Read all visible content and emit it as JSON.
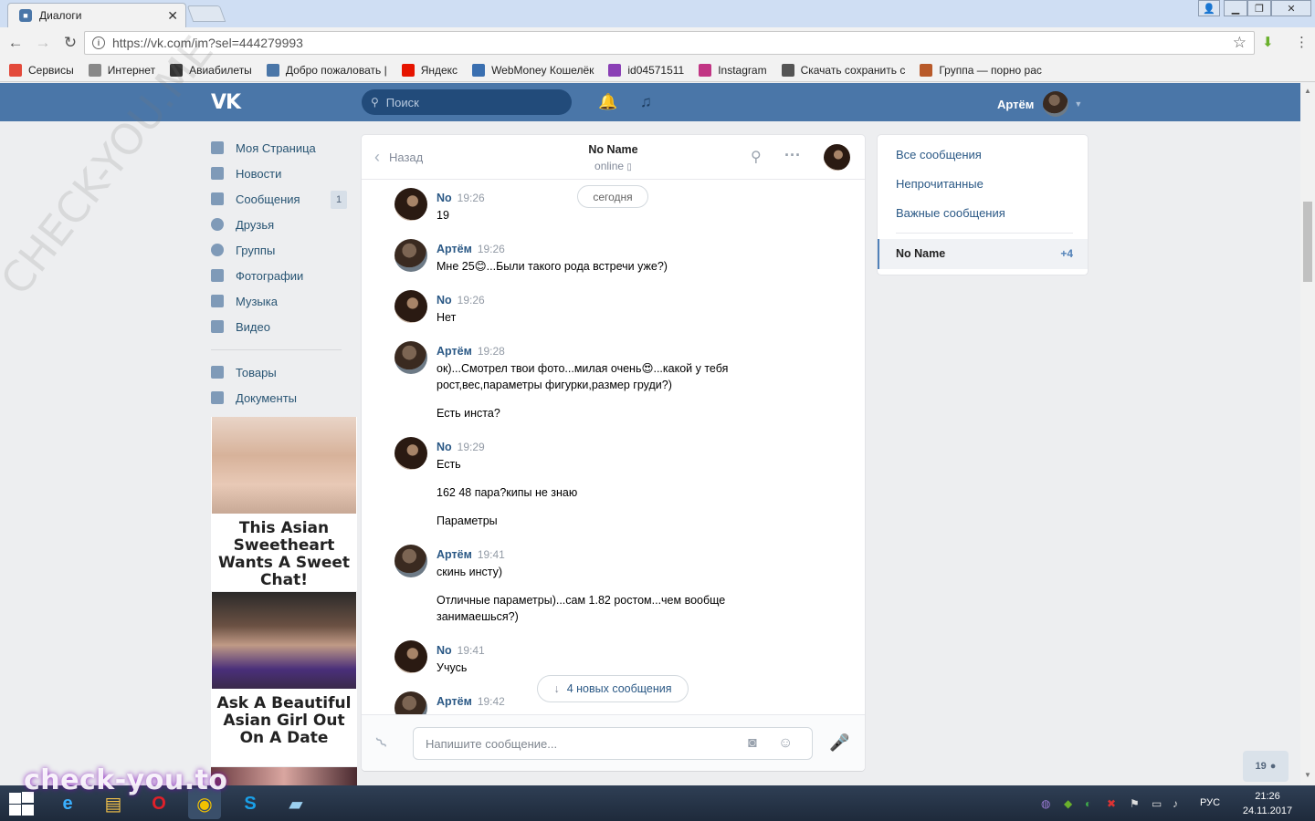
{
  "browser": {
    "tab_title": "Диалоги",
    "url": "https://vk.com/im?sel=444279993",
    "bookmarks": [
      {
        "label": "Сервисы",
        "icon": "apps-grid-icon",
        "color": "#e34a3b"
      },
      {
        "label": "Интернет",
        "icon": "page-icon",
        "color": "#888888"
      },
      {
        "label": "Авиабилеты",
        "icon": "plane-icon",
        "color": "#333333"
      },
      {
        "label": "Добро пожаловать |",
        "icon": "vk-icon",
        "color": "#4a76a8"
      },
      {
        "label": "Яндекс",
        "icon": "yandex-icon",
        "color": "#e61400"
      },
      {
        "label": "WebMoney Кошелёк",
        "icon": "globe-icon",
        "color": "#3a6fb0"
      },
      {
        "label": "id04571511",
        "icon": "s-icon",
        "color": "#8a3fb5"
      },
      {
        "label": "Instagram",
        "icon": "instagram-icon",
        "color": "#c13584"
      },
      {
        "label": "Скачать сохранить с",
        "icon": "download-icon",
        "color": "#555555"
      },
      {
        "label": "Группа — порно рас",
        "icon": "owl-icon",
        "color": "#b85a2a"
      }
    ]
  },
  "vk": {
    "search_placeholder": "Поиск",
    "user_name": "Артём",
    "nav": [
      {
        "label": "Моя Страница",
        "icon": "home-icon"
      },
      {
        "label": "Новости",
        "icon": "news-icon"
      },
      {
        "label": "Сообщения",
        "icon": "messages-icon",
        "badge": "1"
      },
      {
        "label": "Друзья",
        "icon": "friends-icon"
      },
      {
        "label": "Группы",
        "icon": "groups-icon"
      },
      {
        "label": "Фотографии",
        "icon": "camera-icon"
      },
      {
        "label": "Музыка",
        "icon": "music-icon"
      },
      {
        "label": "Видео",
        "icon": "video-icon"
      },
      {
        "label": "Товары",
        "icon": "bag-icon"
      },
      {
        "label": "Документы",
        "icon": "document-icon"
      }
    ],
    "ads": [
      {
        "title": "This Asian Sweetheart Wants A Sweet Chat!"
      },
      {
        "title": "Ask A Beautiful Asian Girl Out On A Date"
      }
    ]
  },
  "chat": {
    "back_label": "Назад",
    "peer_name": "No Name",
    "peer_status": "online",
    "date_label": "сегодня",
    "messages": [
      {
        "author": "No",
        "time": "19:26",
        "lines": [
          "19"
        ]
      },
      {
        "author": "Артём",
        "time": "19:26",
        "lines": [
          "Мне 25😊...Были такого рода встречи уже?)"
        ]
      },
      {
        "author": "No",
        "time": "19:26",
        "lines": [
          "Нет"
        ]
      },
      {
        "author": "Артём",
        "time": "19:28",
        "lines": [
          "ок)...Смотрел твои фото...милая очень😍...какой у тебя рост,вес,параметры фигурки,размер груди?)",
          "Есть инста?"
        ]
      },
      {
        "author": "No",
        "time": "19:29",
        "lines": [
          "Есть",
          "162 48 пара?кипы не знаю",
          "Параметры"
        ]
      },
      {
        "author": "Артём",
        "time": "19:41",
        "lines": [
          "скинь инсту)",
          "Отличные параметры)...сам 1.82 ростом...чем вообще занимаешься?)"
        ]
      },
      {
        "author": "No",
        "time": "19:41",
        "lines": [
          "Учусь"
        ]
      },
      {
        "author": "Артём",
        "time": "19:42",
        "lines": [
          ""
        ]
      }
    ],
    "new_messages_label": "4 новых сообщения",
    "composer_placeholder": "Напишите сообщение..."
  },
  "right_panel": {
    "all_messages": "Все сообщения",
    "unread": "Непрочитанные",
    "important": "Важные сообщения",
    "active_chat": "No Name",
    "active_count": "+4"
  },
  "online_widget": "19",
  "taskbar": {
    "lang": "РУС",
    "time": "21:26",
    "date": "24.11.2017"
  },
  "watermark": "check-you.to",
  "watermark_diag": "CHECK-YOU.ME"
}
